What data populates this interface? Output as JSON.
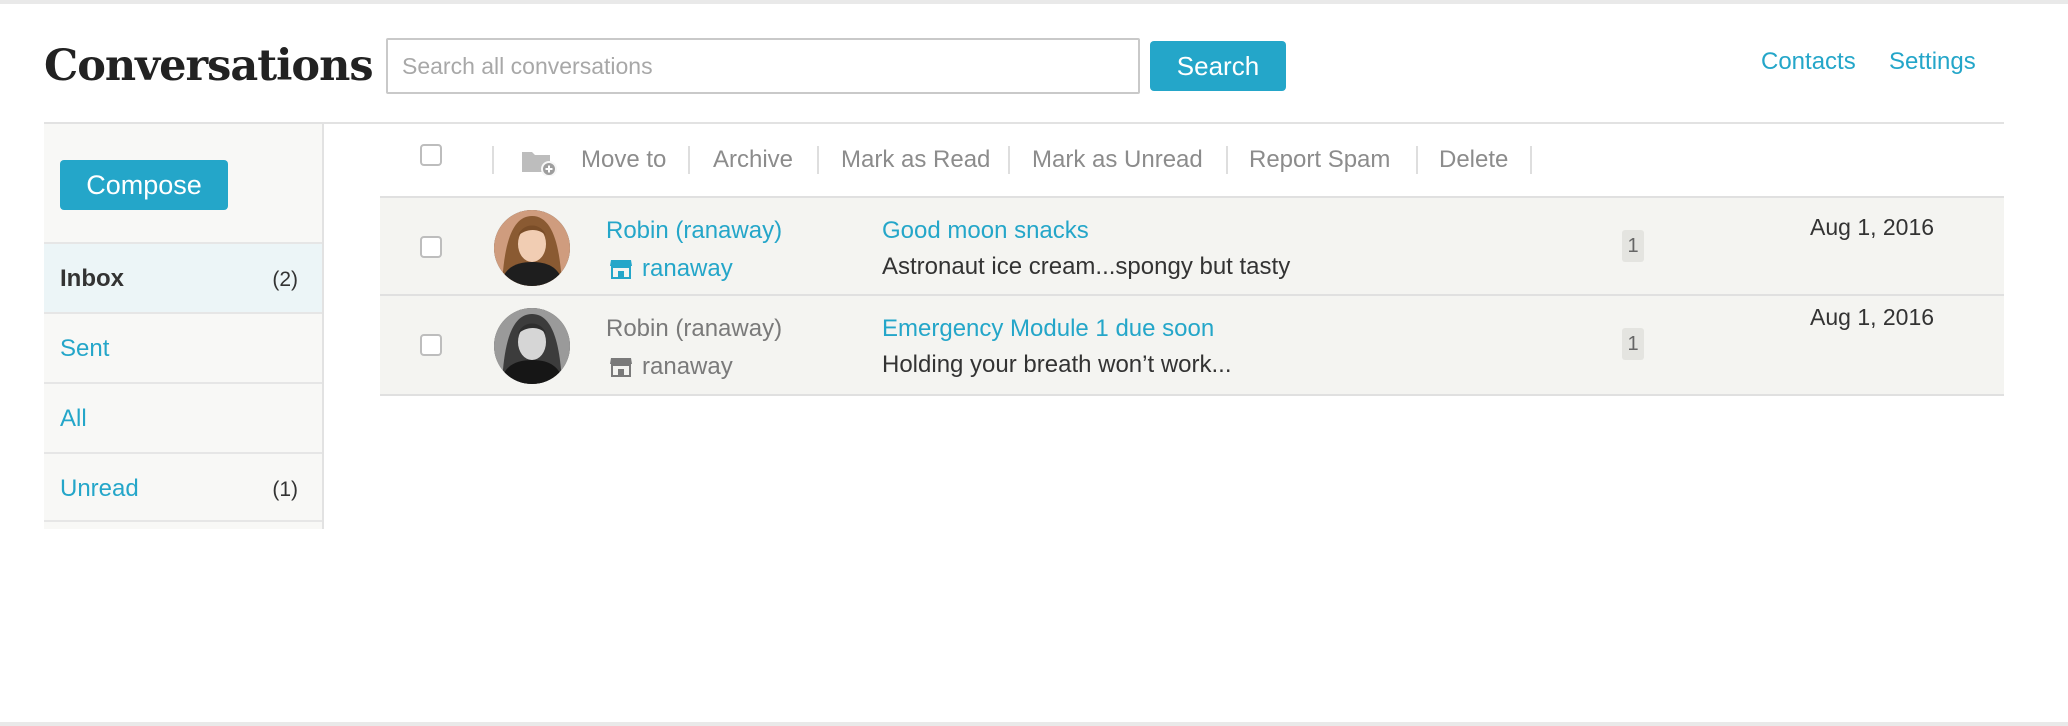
{
  "header": {
    "title": "Conversations",
    "search_placeholder": "Search all conversations",
    "search_button": "Search",
    "links": {
      "contacts": "Contacts",
      "settings": "Settings"
    }
  },
  "sidebar": {
    "compose": "Compose",
    "folders": [
      {
        "label": "Inbox",
        "count": "(2)",
        "active": true
      },
      {
        "label": "Sent",
        "count": ""
      },
      {
        "label": "All",
        "count": ""
      },
      {
        "label": "Unread",
        "count": "(1)"
      }
    ]
  },
  "toolbar": {
    "actions": {
      "move_to": "Move to",
      "archive": "Archive",
      "mark_read": "Mark as Read",
      "mark_unread": "Mark as Unread",
      "report_spam": "Report Spam",
      "delete": "Delete"
    },
    "icons": {
      "move_to": "folder-add-icon"
    }
  },
  "conversations": [
    {
      "sender": "Robin (ranaway)",
      "store": "ranaway",
      "store_icon": "storefront-icon",
      "subject": "Good moon snacks",
      "snippet": "Astronaut ice cream...spongy but tasty",
      "count": "1",
      "date": "Aug 1, 2016",
      "unread": true
    },
    {
      "sender": "Robin (ranaway)",
      "store": "ranaway",
      "store_icon": "storefront-icon",
      "subject": "Emergency Module 1 due soon",
      "snippet": "Holding your breath won’t work...",
      "count": "1",
      "date": "Aug 1, 2016",
      "unread": false
    }
  ],
  "colors": {
    "accent": "#24a6c9",
    "row_background": "#f4f4f1",
    "active_folder": "#ecf5f7"
  }
}
